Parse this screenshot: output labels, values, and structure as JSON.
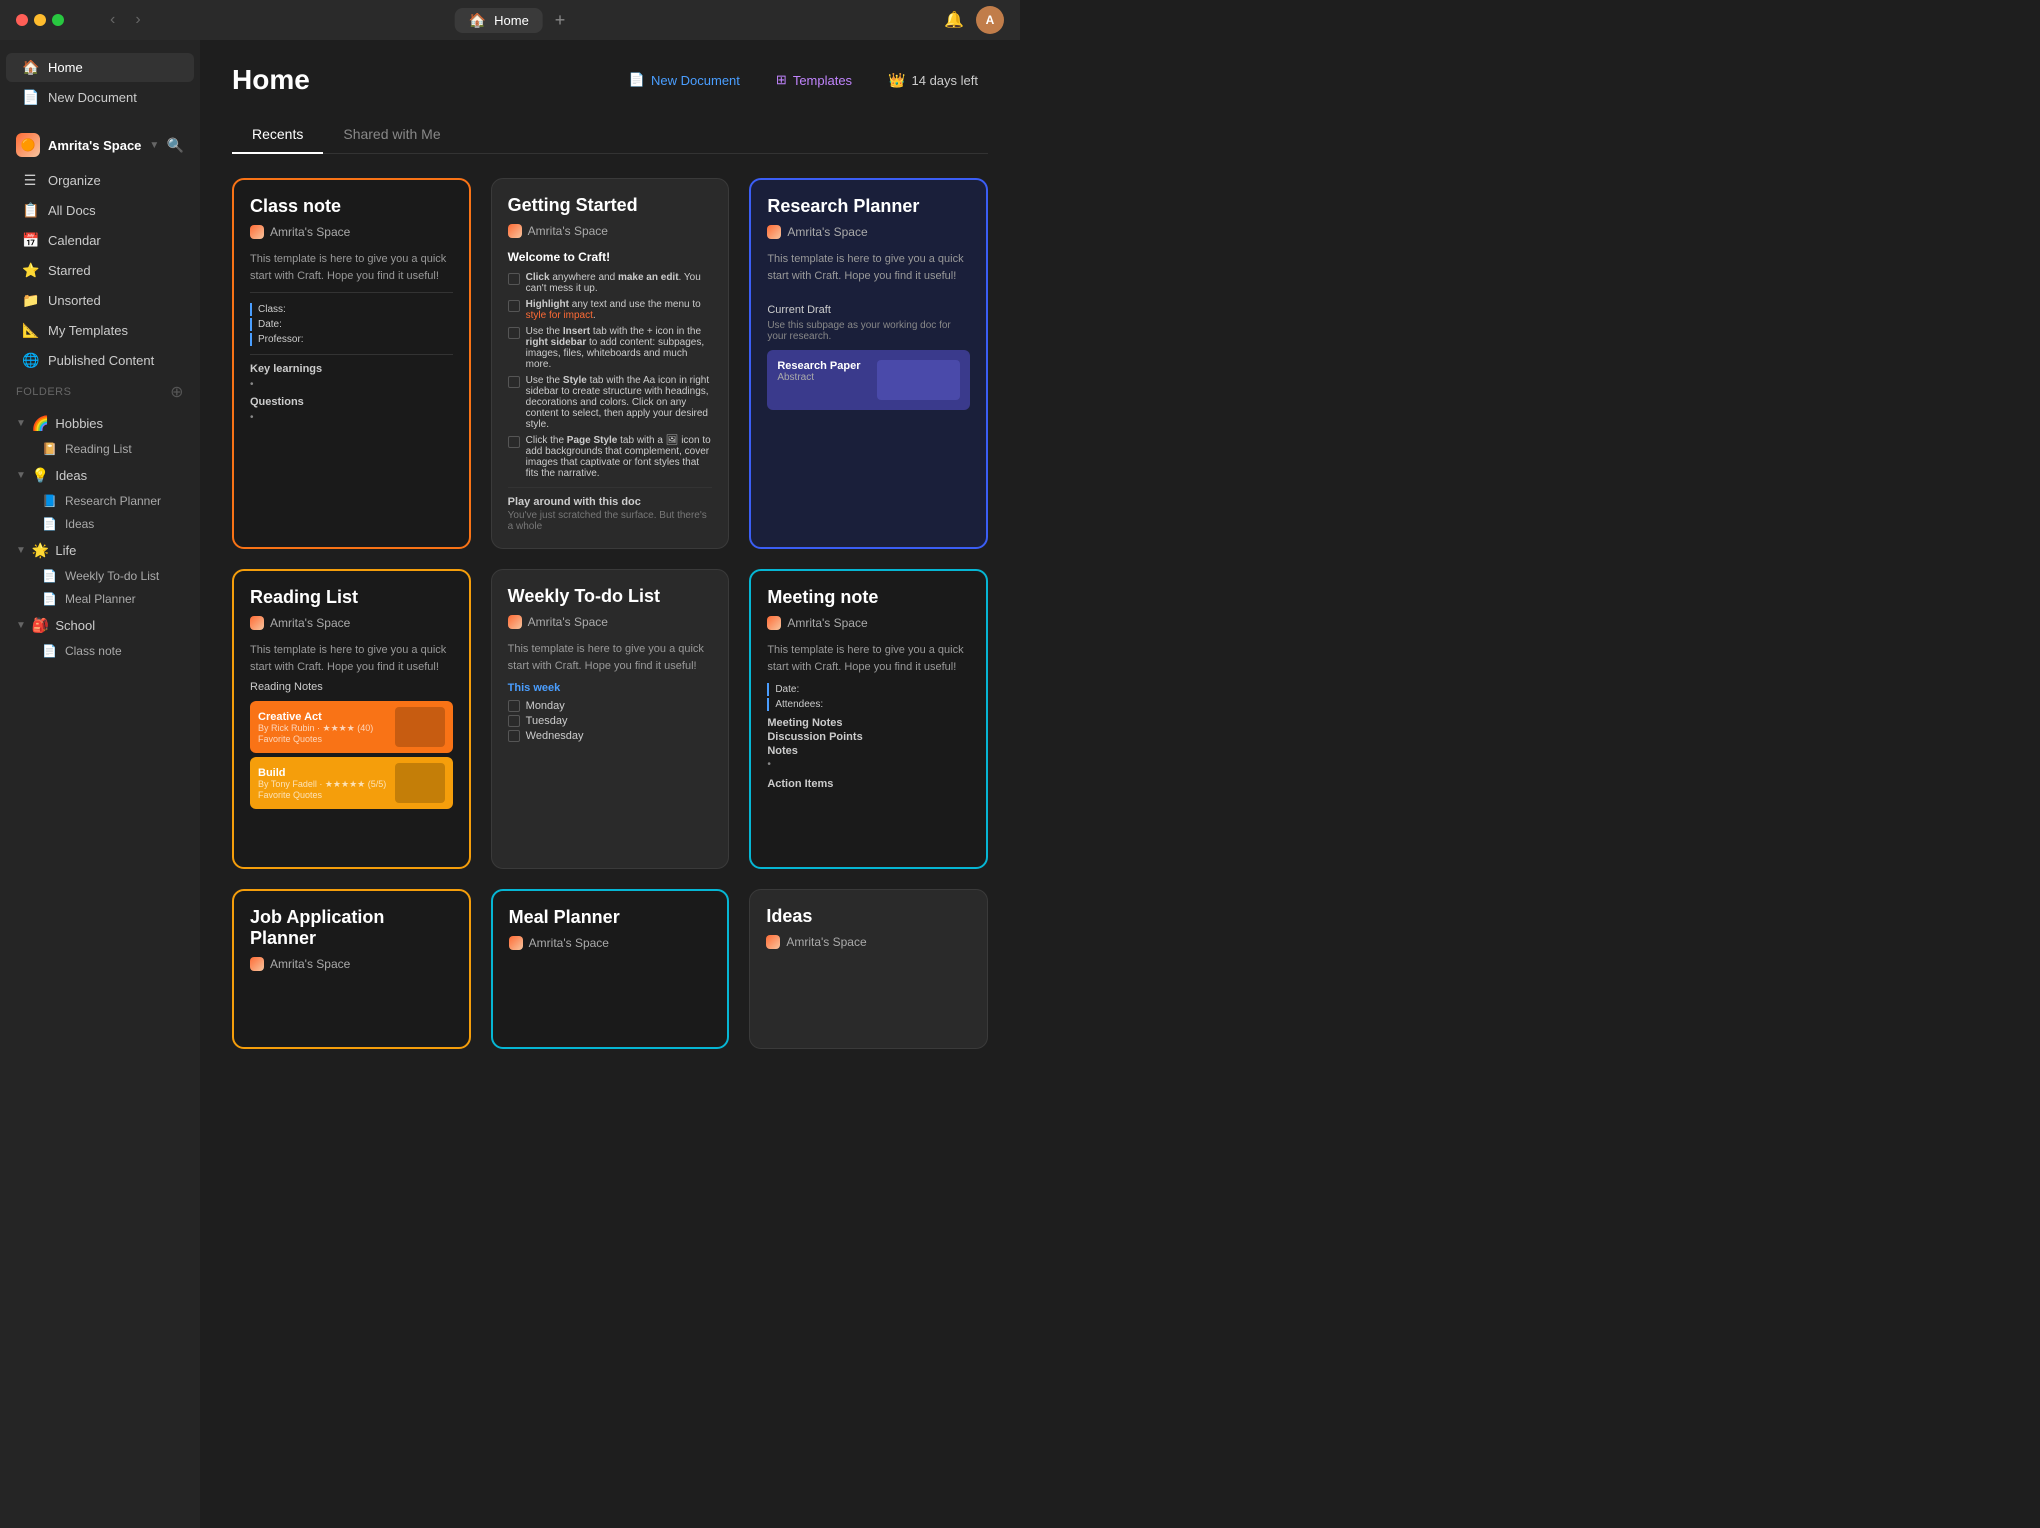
{
  "titlebar": {
    "home_label": "Home",
    "add_tab": "+",
    "bell_icon": "🔔",
    "avatar_label": "A"
  },
  "sidebar": {
    "nav_items": [
      {
        "id": "home",
        "icon": "🏠",
        "label": "Home",
        "active": true
      },
      {
        "id": "new-doc",
        "icon": "📄",
        "label": "New Document",
        "active": false
      }
    ],
    "space_name": "Amrita's Space",
    "space_menu_items": [
      {
        "id": "organize",
        "icon": "☰",
        "label": "Organize"
      },
      {
        "id": "all-docs",
        "icon": "📋",
        "label": "All Docs"
      },
      {
        "id": "calendar",
        "icon": "📅",
        "label": "Calendar"
      },
      {
        "id": "starred",
        "icon": "⭐",
        "label": "Starred"
      },
      {
        "id": "unsorted",
        "icon": "📁",
        "label": "Unsorted"
      },
      {
        "id": "my-templates",
        "icon": "📐",
        "label": "My Templates"
      },
      {
        "id": "published",
        "icon": "🌐",
        "label": "Published Content"
      }
    ],
    "folders_label": "Folders",
    "folders": [
      {
        "id": "hobbies",
        "emoji": "🌈",
        "label": "Hobbies",
        "children": [
          {
            "id": "reading-list",
            "label": "Reading List",
            "icon": "📔"
          }
        ]
      },
      {
        "id": "ideas",
        "emoji": "💡",
        "label": "Ideas",
        "children": [
          {
            "id": "research-planner",
            "label": "Research Planner",
            "icon": "📘"
          },
          {
            "id": "ideas-doc",
            "label": "Ideas",
            "icon": "📄"
          }
        ]
      },
      {
        "id": "life",
        "emoji": "🌟",
        "label": "Life",
        "children": [
          {
            "id": "weekly-todo",
            "label": "Weekly To-do List",
            "icon": "📄"
          },
          {
            "id": "meal-planner",
            "label": "Meal Planner",
            "icon": "📄"
          }
        ]
      },
      {
        "id": "school",
        "emoji": "🎒",
        "label": "School",
        "children": [
          {
            "id": "class-note",
            "label": "Class note",
            "icon": "📄"
          }
        ]
      }
    ]
  },
  "content": {
    "title": "Home",
    "actions": {
      "new_doc_icon": "📄",
      "new_doc_label": "New Document",
      "templates_icon": "⊞",
      "templates_label": "Templates",
      "trial_icon": "👑",
      "trial_label": "14 days left"
    },
    "tabs": [
      {
        "id": "recents",
        "label": "Recents",
        "active": true
      },
      {
        "id": "shared",
        "label": "Shared with Me",
        "active": false
      }
    ],
    "cards": [
      {
        "id": "class-note",
        "title": "Class note",
        "space": "Amrita's Space",
        "style": "orange",
        "body": "This template is here to give you a quick start with Craft. Hope you find it useful!",
        "fields": [
          "Class:",
          "Date:",
          "Professor:"
        ],
        "section": "Key learnings",
        "section2": "Questions"
      },
      {
        "id": "getting-started",
        "title": "Getting Started",
        "space": "Amrita's Space",
        "style": "dark",
        "welcome": "Welcome to Craft!",
        "items": [
          "Click anywhere and make an edit. You can't mess it up.",
          "Highlight any text and use the menu to style for impact.",
          "Use the Insert tab with the + icon in the right sidebar to add content: subpages, images, files, whiteboards and much more.",
          "Use the Style tab with the Aa icon in right sidebar to create structure with headings, decorations and colors.",
          "Click the Page Style tab with a icon to add backgrounds that complement, cover images that captivate or font styles that fits the narrative."
        ],
        "play_label": "Play around with this doc",
        "play_sub": "You've just scratched the surface. But there's a whole"
      },
      {
        "id": "research-planner",
        "title": "Research Planner",
        "space": "Amrita's Space",
        "style": "blue",
        "body": "This template is here to give you a quick start with Craft. Hope you find it useful!",
        "current_draft": "Current Draft",
        "current_draft_sub": "Use this subpage as your working doc for your research.",
        "inner_title": "Research Paper",
        "inner_sub": "Abstract"
      },
      {
        "id": "reading-list",
        "title": "Reading List",
        "space": "Amrita's Space",
        "style": "yellow",
        "body": "This template is here to give you a quick start with Craft. Hope you find it useful!",
        "reading_notes_label": "Reading Notes",
        "books": [
          {
            "title": "Creative Act",
            "author": "By Rick Rubin",
            "color": "orange"
          },
          {
            "title": "Build",
            "author": "By Tony Fadell",
            "color": "yellow"
          }
        ]
      },
      {
        "id": "weekly-todo",
        "title": "Weekly To-do List",
        "space": "Amrita's Space",
        "style": "dark",
        "body": "This template is here to give you a quick start with Craft. Hope you find it useful!",
        "this_week": "This week",
        "days": [
          "Monday",
          "Tuesday",
          "Wednesday"
        ]
      },
      {
        "id": "meeting-note",
        "title": "Meeting note",
        "space": "Amrita's Space",
        "style": "cyan",
        "body": "This template is here to give you a quick start with Craft. Hope you find it useful!",
        "fields": [
          "Date:",
          "Attendees:"
        ],
        "sections": [
          "Meeting Notes",
          "Discussion Points",
          "Notes"
        ],
        "action_items": "Action Items"
      },
      {
        "id": "job-application",
        "title": "Job Application Planner",
        "space": "Amrita's Space",
        "style": "orange-partial"
      },
      {
        "id": "meal-planner",
        "title": "Meal Planner",
        "space": "Amrita's Space",
        "style": "cyan-partial"
      },
      {
        "id": "ideas-card",
        "title": "Ideas",
        "space": "Amrita's Space",
        "style": "dark-partial"
      }
    ]
  }
}
